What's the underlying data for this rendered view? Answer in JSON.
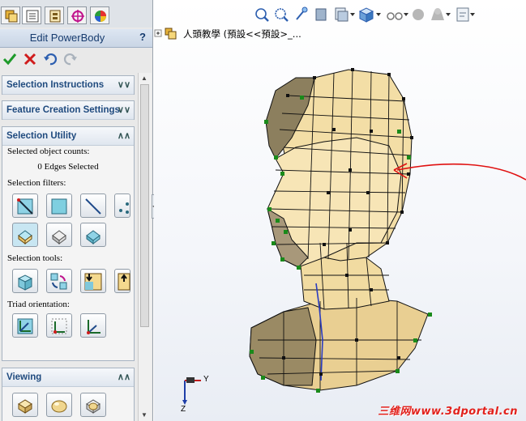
{
  "property_manager": {
    "title": "Edit PowerBody",
    "help": "?",
    "groups": {
      "selection_instructions": "Selection Instructions",
      "feature_creation": "Feature Creation Settings",
      "selection_utility": "Selection Utility",
      "viewing": "Viewing"
    },
    "selected_counts_label": "Selected object counts:",
    "selected_counts_value": "0 Edges Selected",
    "selection_filters_label": "Selection filters:",
    "selection_tools_label": "Selection tools:",
    "triad_orientation_label": "Triad orientation:"
  },
  "viewport": {
    "tree_item": "人頭教學 (預設<<預設>_...",
    "triad_y": "Y",
    "triad_z": "Z",
    "watermark": "三维网www.3dportal.cn"
  },
  "colors": {
    "mesh_face": "#f3dea6",
    "mesh_shadow": "#8c7f5e",
    "mesh_edge": "#111111",
    "vertex": "#1a8a1a",
    "annotation_arrow": "#e01010"
  }
}
